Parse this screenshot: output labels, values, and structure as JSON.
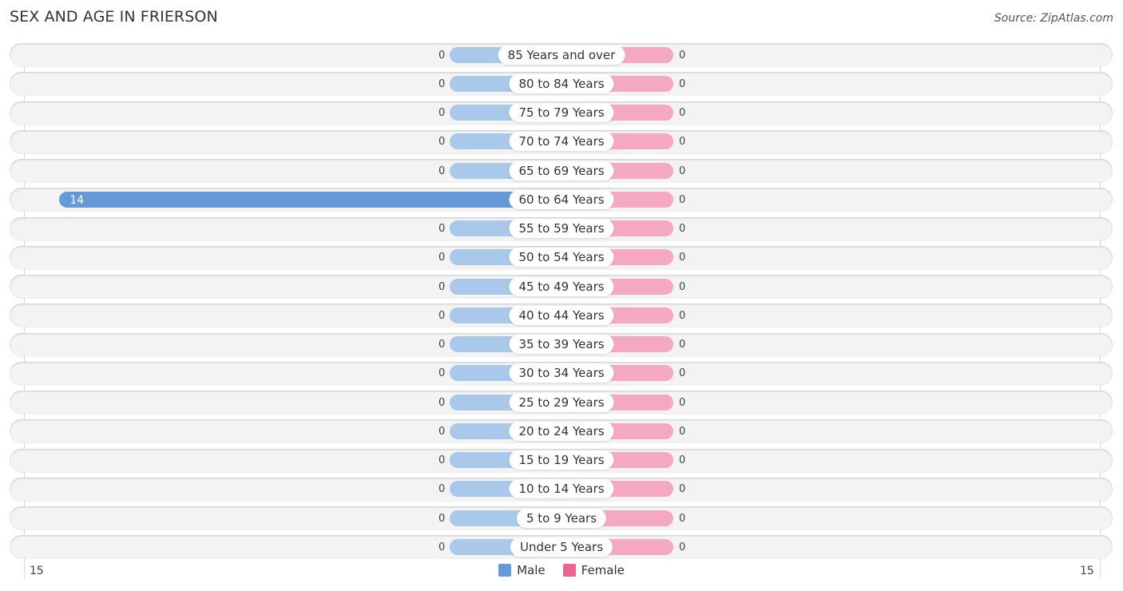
{
  "header": {
    "title": "SEX AND AGE IN FRIERSON",
    "source": "Source: ZipAtlas.com"
  },
  "colors": {
    "male": "#6699d8",
    "male_light": "#a9c8ea",
    "female": "#f06292",
    "female_light": "#f5a8c2"
  },
  "chart_data": {
    "type": "bar",
    "orientation": "horizontal-diverging",
    "title": "SEX AND AGE IN FRIERSON",
    "categories": [
      "85 Years and over",
      "80 to 84 Years",
      "75 to 79 Years",
      "70 to 74 Years",
      "65 to 69 Years",
      "60 to 64 Years",
      "55 to 59 Years",
      "50 to 54 Years",
      "45 to 49 Years",
      "40 to 44 Years",
      "35 to 39 Years",
      "30 to 34 Years",
      "25 to 29 Years",
      "20 to 24 Years",
      "15 to 19 Years",
      "10 to 14 Years",
      "5 to 9 Years",
      "Under 5 Years"
    ],
    "series": [
      {
        "name": "Male",
        "values": [
          0,
          0,
          0,
          0,
          0,
          14,
          0,
          0,
          0,
          0,
          0,
          0,
          0,
          0,
          0,
          0,
          0,
          0
        ]
      },
      {
        "name": "Female",
        "values": [
          0,
          0,
          0,
          0,
          0,
          0,
          0,
          0,
          0,
          0,
          0,
          0,
          0,
          0,
          0,
          0,
          0,
          0
        ]
      }
    ],
    "xlim": [
      -15,
      15
    ],
    "tick_labels": {
      "left": "15",
      "right": "15"
    },
    "legend": {
      "position": "bottom-center",
      "entries": [
        "Male",
        "Female"
      ]
    },
    "grid": false
  }
}
